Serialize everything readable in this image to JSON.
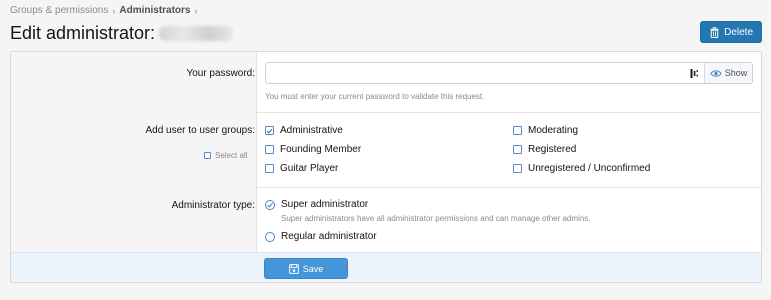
{
  "breadcrumb": {
    "items": [
      "Groups & permissions",
      "Administrators"
    ]
  },
  "header": {
    "title": "Edit administrator:",
    "delete_label": "Delete"
  },
  "form": {
    "password": {
      "label": "Your password:",
      "value": "",
      "show_label": "Show",
      "hint": "You must enter your current password to validate this request."
    },
    "groups": {
      "label": "Add user to user groups:",
      "select_all_label": "Select all",
      "items": [
        {
          "label": "Administrative",
          "checked": true
        },
        {
          "label": "Founding Member",
          "checked": false
        },
        {
          "label": "Guitar Player",
          "checked": false
        },
        {
          "label": "Moderating",
          "checked": false
        },
        {
          "label": "Registered",
          "checked": false
        },
        {
          "label": "Unregistered / Unconfirmed",
          "checked": false
        }
      ]
    },
    "admin_type": {
      "label": "Administrator type:",
      "options": [
        {
          "label": "Super administrator",
          "selected": true,
          "hint": "Super administrators have all administrator permissions and can manage other admins."
        },
        {
          "label": "Regular administrator",
          "selected": false
        }
      ]
    },
    "save_label": "Save"
  },
  "colors": {
    "accent": "#2577b1",
    "save_button": "#4595d9",
    "checkbox_border": "#5b8ec0"
  },
  "icons": [
    "chevron-right-icon",
    "trash-icon",
    "password-manager-icon",
    "eye-icon",
    "checkmark-icon",
    "radio-check-icon",
    "save-icon"
  ]
}
